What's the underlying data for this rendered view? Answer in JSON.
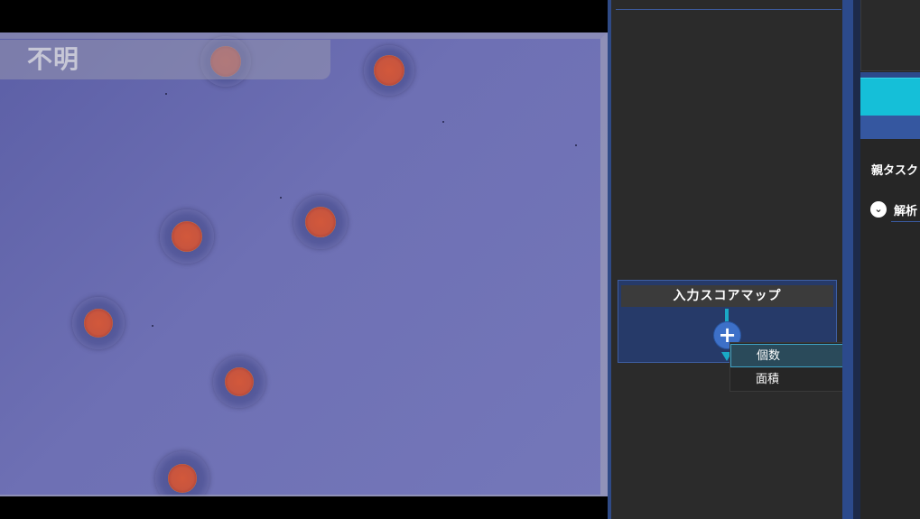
{
  "viewer": {
    "class_label": "不明"
  },
  "node": {
    "title": "入力スコアマップ",
    "add_icon": "plus-icon"
  },
  "menu": {
    "items": [
      {
        "label": "個数"
      },
      {
        "label": "面積"
      }
    ]
  },
  "right_panel": {
    "parent_task_label": "親タスク",
    "analysis_label": "解析",
    "chevron_icon": "chevron-down-icon"
  },
  "colors": {
    "accent_blue": "#2c4a8c",
    "accent_cyan": "#15bfd8",
    "panel_bg": "#2b2b2b",
    "node_bg": "#263a69"
  }
}
